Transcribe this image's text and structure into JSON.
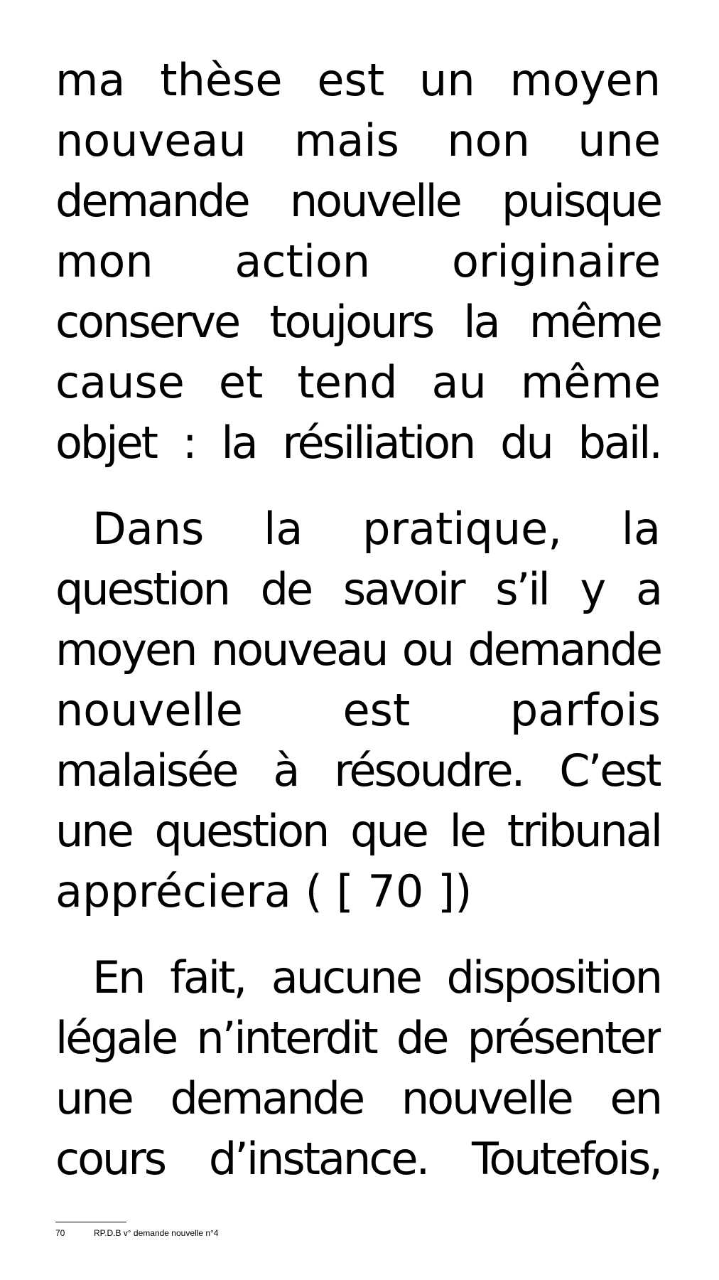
{
  "paragraphs": [
    {
      "indent": false,
      "lines": [
        "ma thèse est un moyen",
        "nouveau mais non une",
        "demande nouvelle puisque",
        "mon action originaire",
        "conserve toujours la même",
        "cause et tend au même",
        "objet : la résiliation du bail."
      ]
    },
    {
      "indent": true,
      "lines": [
        "Dans la pratique, la",
        "question de savoir s’il y a",
        "moyen nouveau ou demande",
        "nouvelle est parfois",
        "malaisée à résoudre. C’est",
        "une question que le tribunal",
        "appréciera ( [ 70 ])"
      ]
    },
    {
      "indent": true,
      "lines": [
        "En fait, aucune disposition",
        "légale n’interdit de présenter",
        "une demande nouvelle en",
        "cours d’instance. Toutefois,"
      ]
    }
  ],
  "footnote": {
    "number": "70",
    "text": "RP.D.B v° demande nouvelle n°4"
  }
}
